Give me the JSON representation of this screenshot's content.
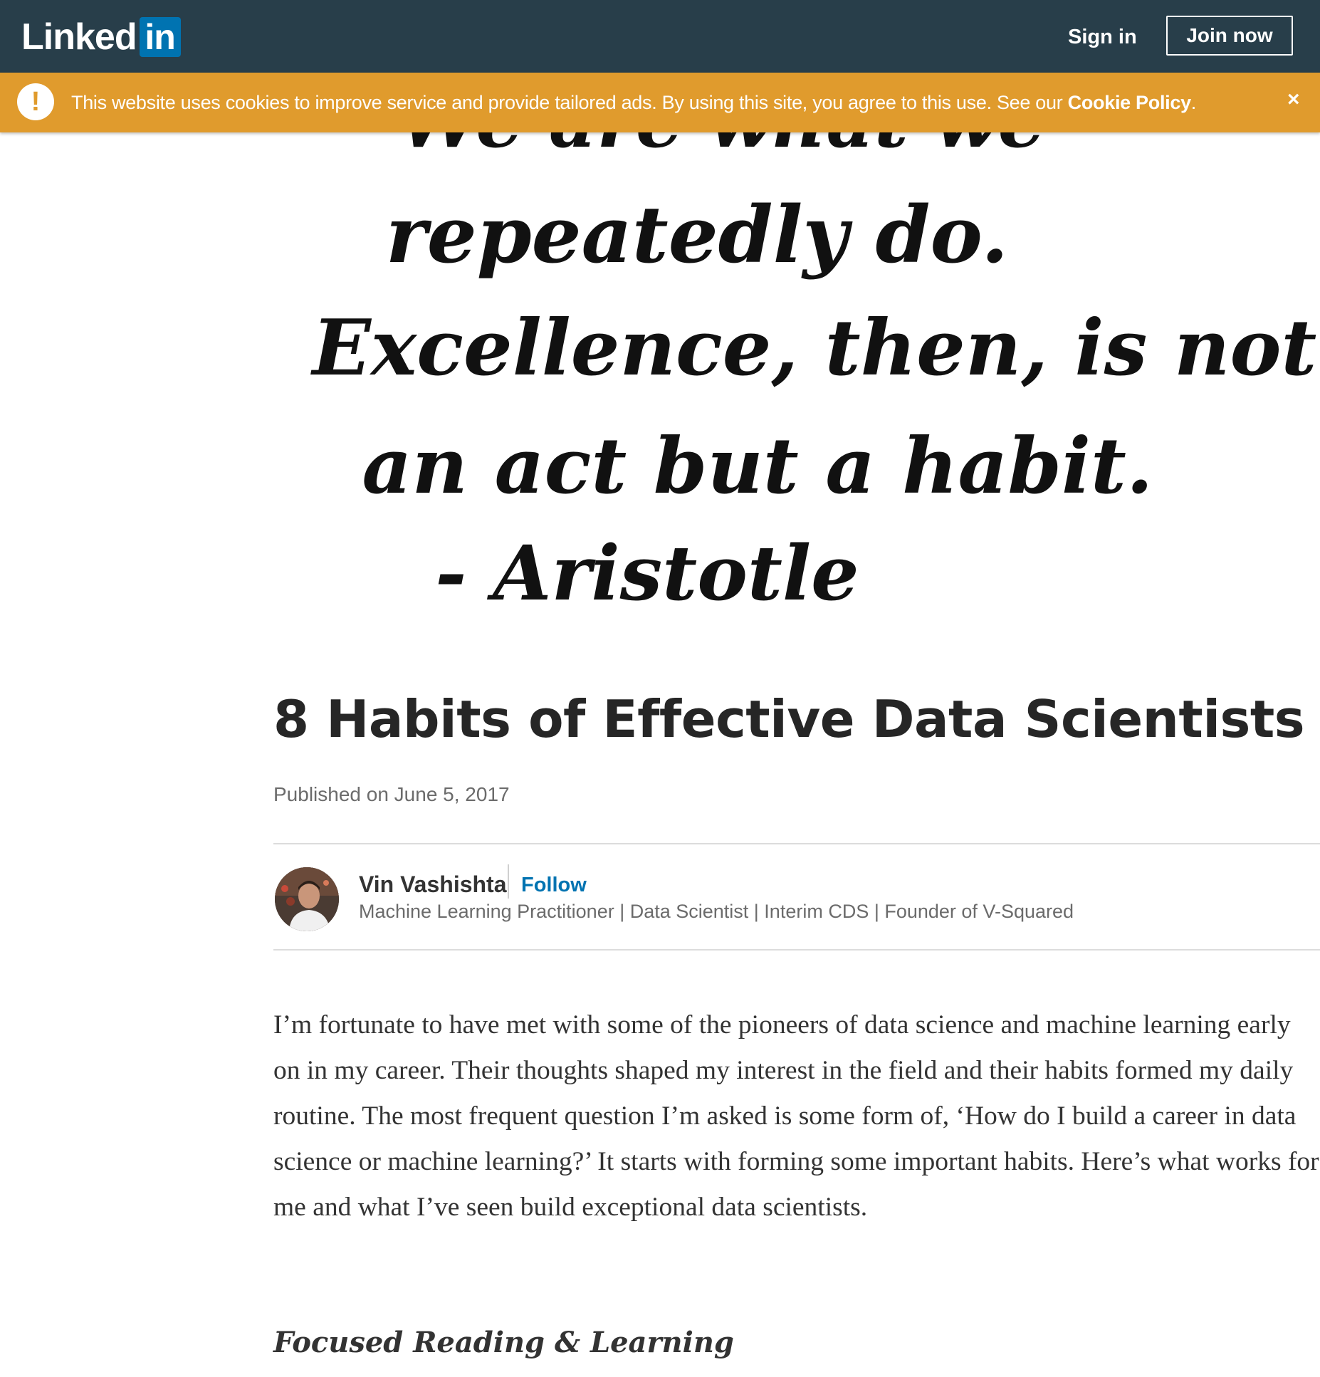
{
  "nav": {
    "logo_linked": "Linked",
    "logo_in": "in",
    "sign_in": "Sign in",
    "join_now": "Join now"
  },
  "cookie_banner": {
    "icon": "!",
    "text": "This website uses cookies to improve service and provide tailored ads. By using this site, you agree to this use. See our ",
    "link": "Cookie Policy",
    "after_link": ".",
    "close": "×"
  },
  "hero_quote": {
    "line1": "We are what we",
    "line2": "repeatedly do.",
    "line3": "Excellence, then, is not",
    "line4": "an act but a habit.",
    "line5": "- Aristotle"
  },
  "article": {
    "title": "8 Habits of Effective Data Scientists",
    "published": "Published on June 5, 2017",
    "author": {
      "name": "Vin Vashishta",
      "follow": "Follow",
      "headline": "Machine Learning Practitioner | Data Scientist | Interim CDS | Founder of V-Squared"
    },
    "body": "I’m fortunate to have met with some of the pioneers of data science and machine learning early on in my career. Their thoughts shaped my interest in the field and their habits formed my daily routine. The most frequent question I’m asked is some form of, ‘How do I build a career in data science or machine learning?’ It starts with forming some important habits. Here’s what works for me and what I’ve seen build exceptional data scientists.",
    "section_heading": "Focused Reading & Learning"
  },
  "colors": {
    "nav_bg": "#283e4a",
    "logo_in_bg": "#0073b1",
    "cookie_bg": "#e09b2d",
    "follow": "#0073b1"
  },
  "icons": {
    "cookie_alert": "exclamation-circle-icon",
    "cookie_close": "close-icon"
  }
}
